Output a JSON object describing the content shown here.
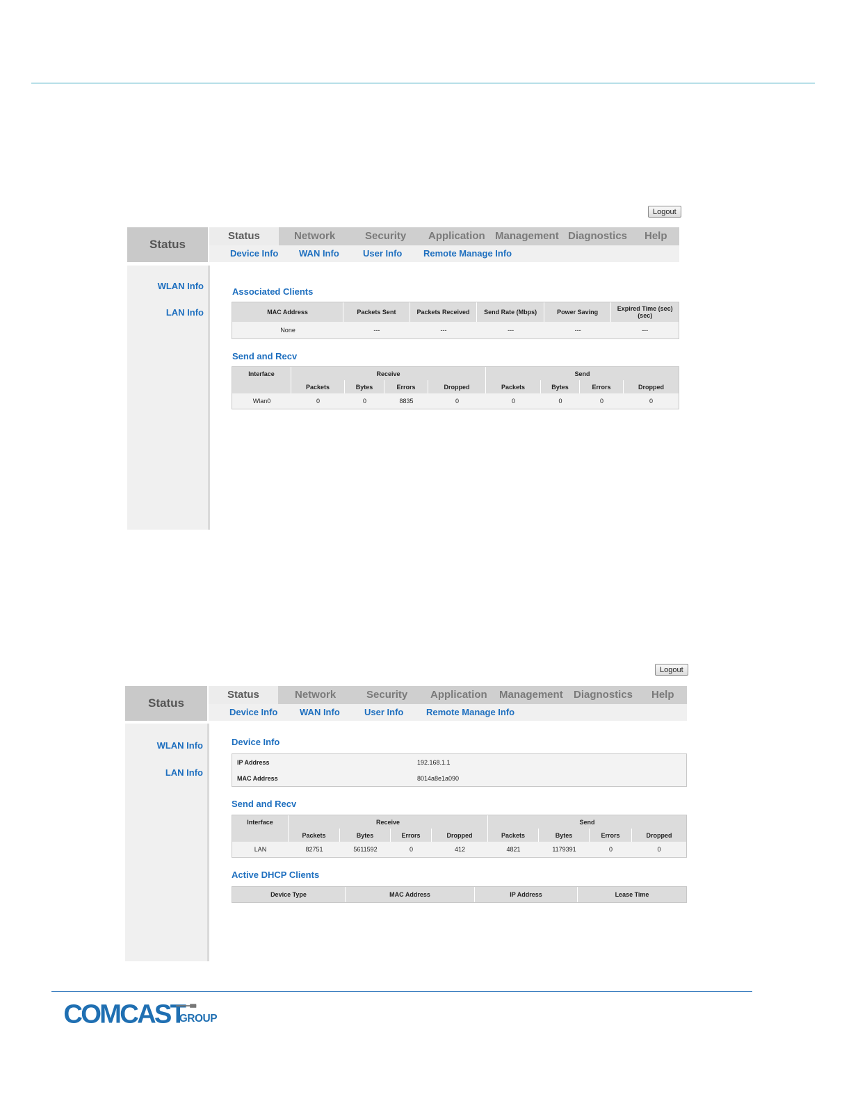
{
  "header": {
    "logout_label": "Logout",
    "section_box": "Status",
    "tabs": [
      "Status",
      "Network",
      "Security",
      "Application",
      "Management",
      "Diagnostics",
      "Help"
    ],
    "subtabs": [
      "Device Info",
      "WAN Info",
      "User Info",
      "Remote Manage Info"
    ]
  },
  "sidebar": {
    "items": [
      "WLAN Info",
      "LAN Info"
    ]
  },
  "wlan_page": {
    "assoc_title": "Associated Clients",
    "assoc_headers": [
      "MAC Address",
      "Packets Sent",
      "Packets Received",
      "Send Rate (Mbps)",
      "Power Saving",
      "Expired Time (sec)",
      "(sec)"
    ],
    "assoc_row": [
      "None",
      "---",
      "---",
      "---",
      "---",
      "---"
    ],
    "sr_title": "Send and Recv",
    "sr_interface": "Interface",
    "sr_receive": "Receive",
    "sr_send": "Send",
    "sr_subheaders": [
      "Packets",
      "Bytes",
      "Errors",
      "Dropped",
      "Packets",
      "Bytes",
      "Errors",
      "Dropped"
    ],
    "sr_row": [
      "Wlan0",
      "0",
      "0",
      "8835",
      "0",
      "0",
      "0",
      "0",
      "0"
    ]
  },
  "lan_page": {
    "device_title": "Device Info",
    "ip_label": "IP Address",
    "ip_value": "192.168.1.1",
    "mac_label": "MAC Address",
    "mac_value": "8014a8e1a090",
    "sr_title": "Send and Recv",
    "sr_interface": "Interface",
    "sr_receive": "Receive",
    "sr_send": "Send",
    "sr_subheaders": [
      "Packets",
      "Bytes",
      "Errors",
      "Dropped",
      "Packets",
      "Bytes",
      "Errors",
      "Dropped"
    ],
    "sr_row": [
      "LAN",
      "82751",
      "5611592",
      "0",
      "412",
      "4821",
      "1179391",
      "0",
      "0"
    ],
    "dhcp_title": "Active DHCP Clients",
    "dhcp_headers": [
      "Device Type",
      "MAC Address",
      "IP Address",
      "Lease Time"
    ]
  },
  "footer": {
    "logo_main": "COMCAST",
    "logo_group": "GROUP",
    "colors": {
      "logo_blue": "#1f6fb2",
      "logo_gray": "#888888"
    }
  }
}
